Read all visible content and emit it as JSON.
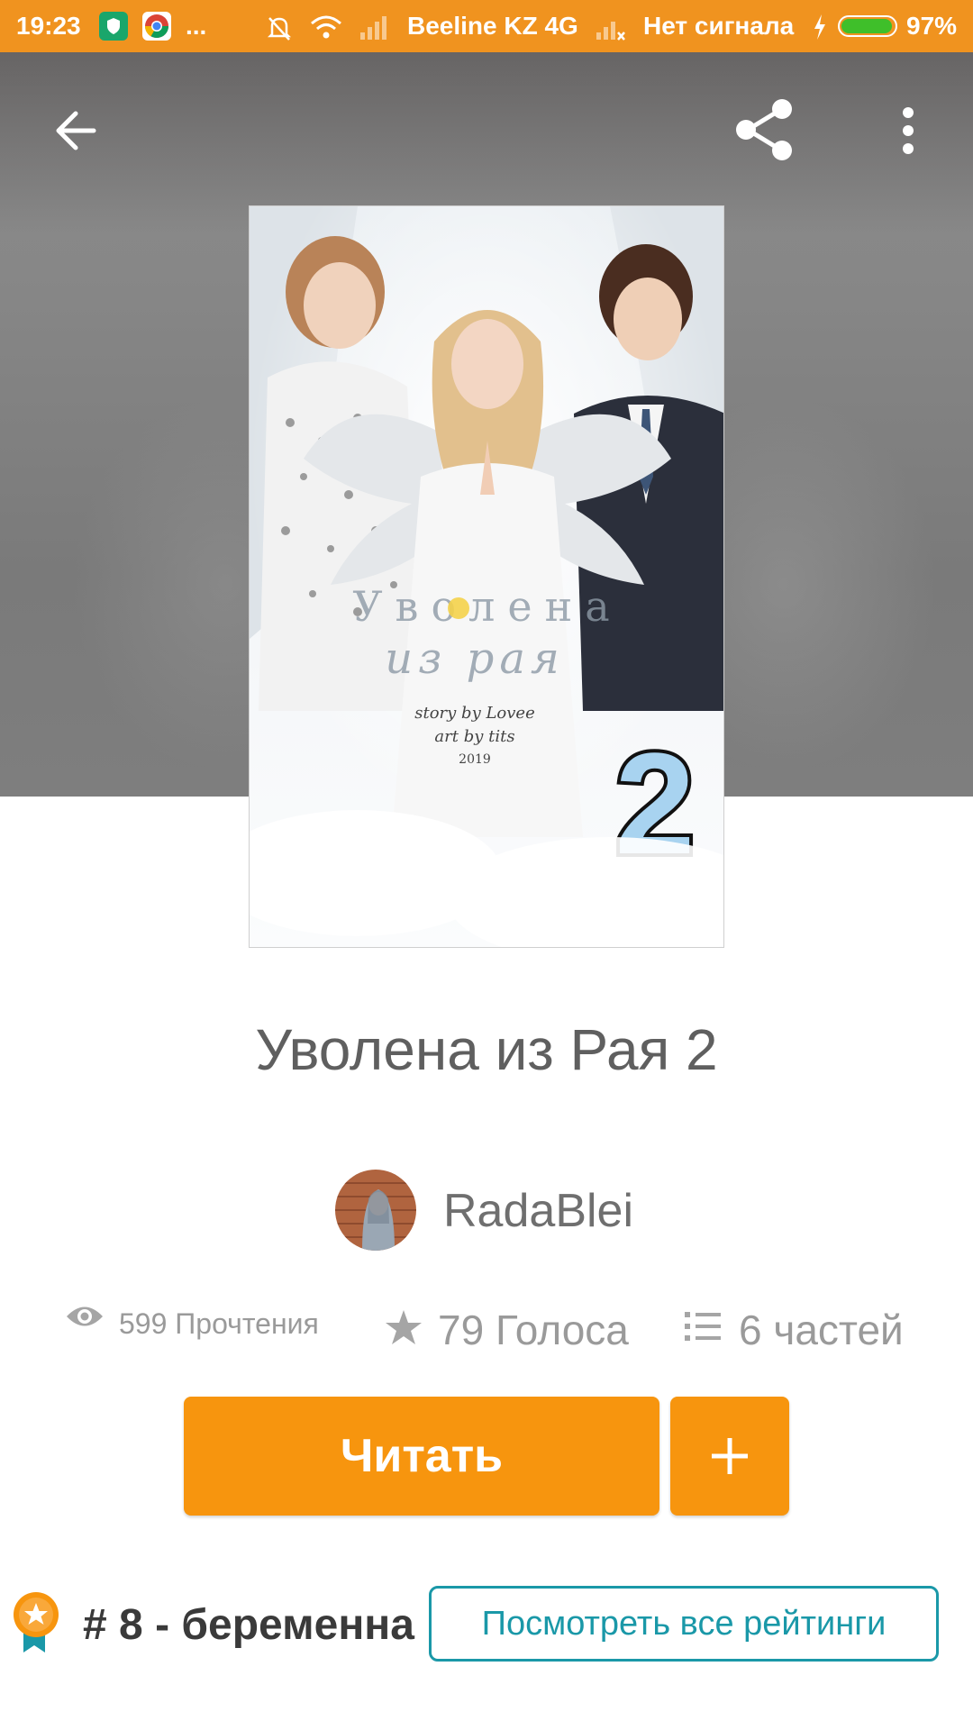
{
  "status_bar": {
    "time": "19:23",
    "more": "...",
    "carrier": "Beeline KZ 4G",
    "no_signal": "Нет сигнала",
    "battery": "97%",
    "battery_level": 0.97,
    "colors": {
      "background": "#f0931f"
    }
  },
  "toolbar": {
    "back_icon": "arrow-left-icon",
    "share_icon": "share-icon",
    "menu_icon": "more-vertical-icon"
  },
  "cover": {
    "line1": "Уволена",
    "line2": "из рая",
    "credit1": "story by Lovee",
    "credit2": "art by tits",
    "year": "2019",
    "number": "2"
  },
  "story": {
    "title": "Уволена из Рая 2",
    "author": "RadaBlei"
  },
  "stats": {
    "reads": "599 Прочтения",
    "votes": "79 Голоса",
    "parts": "6 частей"
  },
  "actions": {
    "read_label": "Читать",
    "add_icon": "plus-icon"
  },
  "ranking": {
    "text": "# 8 - беременна",
    "view_all": "Посмотреть все рейтинги"
  },
  "colors": {
    "accent": "#f7950e",
    "teal": "#1a98a8"
  }
}
